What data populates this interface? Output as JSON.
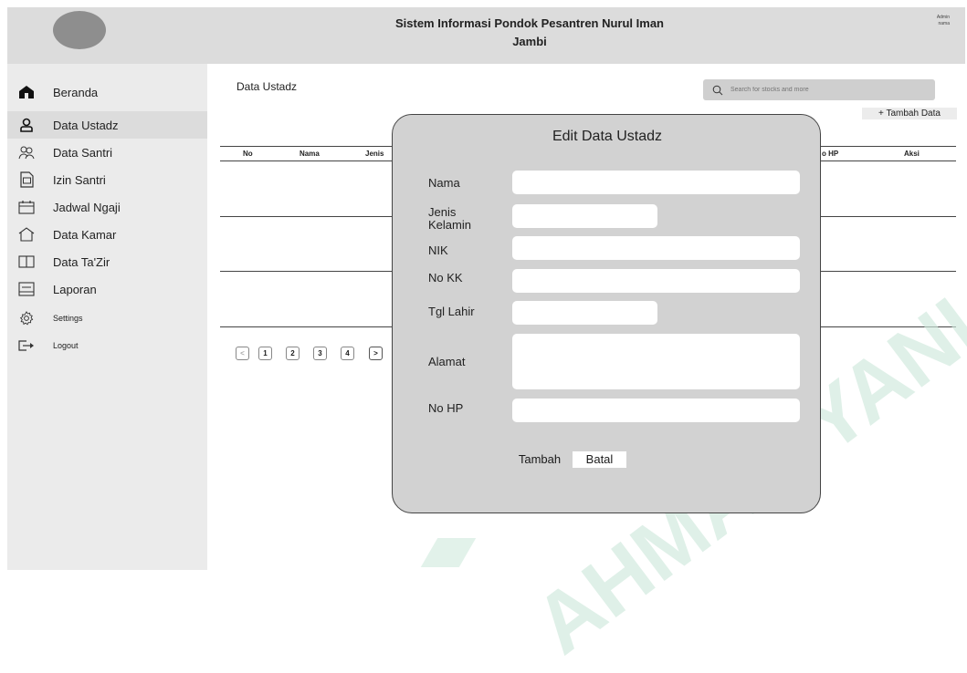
{
  "header": {
    "title": "Sistem Informasi Pondok Pesantren Nurul Iman Jambi",
    "admin_line1": "Admin",
    "admin_line2": "nama"
  },
  "sidebar": {
    "items": [
      {
        "label": "Beranda",
        "icon": "home-icon"
      },
      {
        "label": "Data Ustadz",
        "icon": "user-icon"
      },
      {
        "label": "Data Santri",
        "icon": "users-icon"
      },
      {
        "label": "Izin Santri",
        "icon": "document-icon"
      },
      {
        "label": "Jadwal Ngaji",
        "icon": "calendar-icon"
      },
      {
        "label": "Data Kamar",
        "icon": "house-outline-icon"
      },
      {
        "label": "Data Ta'Zir",
        "icon": "book-icon"
      },
      {
        "label": "Laporan",
        "icon": "report-icon"
      },
      {
        "label": "Settings",
        "icon": "gear-icon"
      },
      {
        "label": "Logout",
        "icon": "logout-icon"
      }
    ]
  },
  "main": {
    "heading": "Data Ustadz",
    "search_placeholder": "Search for stocks and more",
    "add_button": "+ Tambah Data",
    "table": {
      "columns": [
        "No",
        "Nama",
        "Jenis",
        "o HP",
        "Aksi"
      ]
    },
    "pagination": [
      "<",
      "1",
      "2",
      "3",
      "4",
      ">"
    ]
  },
  "modal": {
    "title": "Edit Data Ustadz",
    "fields": [
      {
        "label": "Nama",
        "value": ""
      },
      {
        "label": "Jenis Kelamin",
        "value": ""
      },
      {
        "label": "NIK",
        "value": ""
      },
      {
        "label": "No KK",
        "value": ""
      },
      {
        "label": "Tgl Lahir",
        "value": ""
      },
      {
        "label": "Alamat",
        "value": ""
      },
      {
        "label": "No HP",
        "value": ""
      }
    ],
    "submit_label": "Tambah",
    "cancel_label": "Batal"
  },
  "watermark": "AHMAD YANI",
  "colors": {
    "frame": "#ebebeb",
    "header": "#dcdcdc",
    "modal": "#d2d2d2",
    "watermark": "#cfe9dc"
  }
}
